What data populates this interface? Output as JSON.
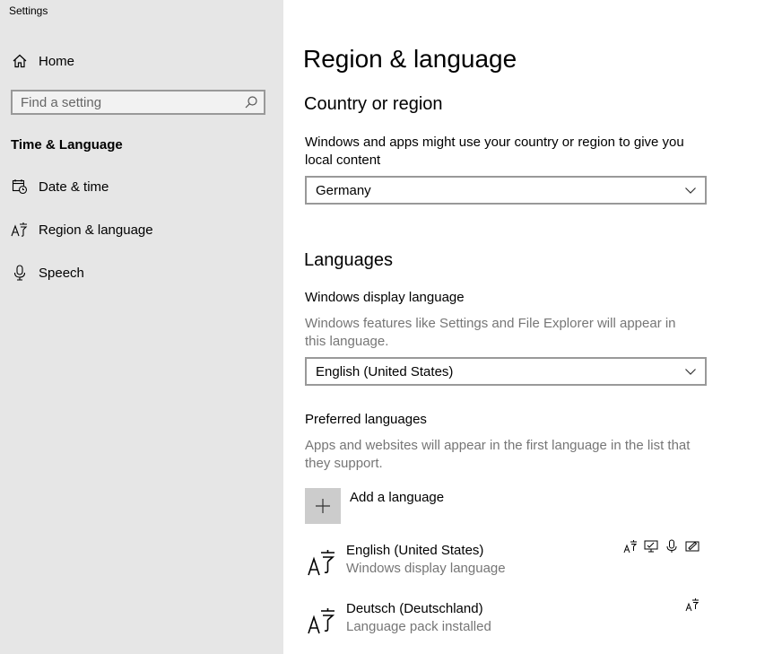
{
  "app": {
    "title": "Settings"
  },
  "sidebar": {
    "home_label": "Home",
    "search_placeholder": "Find a setting",
    "section_title": "Time & Language",
    "items": [
      {
        "label": "Date & time",
        "icon": "calendar-clock-icon"
      },
      {
        "label": "Region & language",
        "icon": "language-icon",
        "selected": true
      },
      {
        "label": "Speech",
        "icon": "microphone-icon"
      }
    ]
  },
  "main": {
    "page_title": "Region & language",
    "country": {
      "heading": "Country or region",
      "description": "Windows and apps might use your country or region to give you local content",
      "selected": "Germany"
    },
    "languages": {
      "heading": "Languages",
      "display_language_label": "Windows display language",
      "display_language_description": "Windows features like Settings and File Explorer will appear in this language.",
      "display_language_selected": "English (United States)",
      "preferred_label": "Preferred languages",
      "preferred_description": "Apps and websites will appear in the first language in the list that they support.",
      "add_language_label": "Add a language",
      "list": [
        {
          "name": "English (United States)",
          "status": "Windows display language",
          "features": [
            "language-pack-icon",
            "display-language-icon",
            "speech-icon",
            "handwriting-icon"
          ]
        },
        {
          "name": "Deutsch (Deutschland)",
          "status": "Language pack installed",
          "features": [
            "language-pack-icon"
          ]
        }
      ]
    }
  },
  "colors": {
    "sidebar_bg": "#e6e6e6",
    "secondary_text": "#767676",
    "border": "#999999"
  }
}
